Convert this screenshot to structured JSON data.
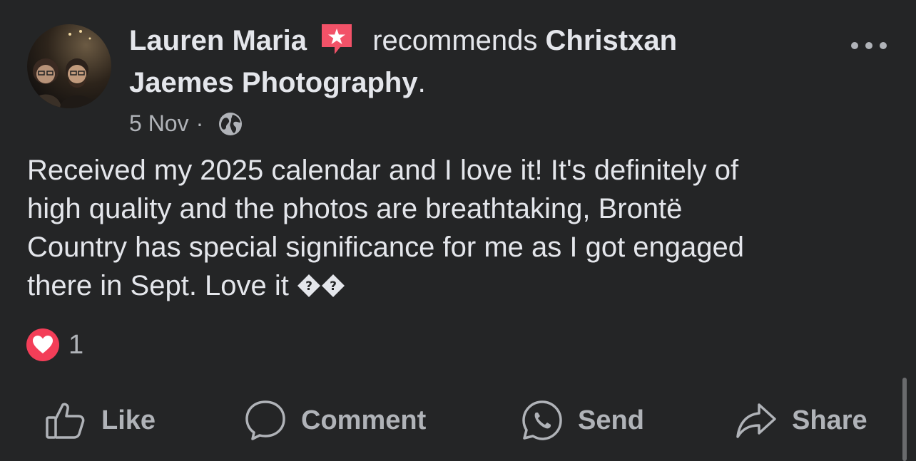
{
  "post": {
    "author": "Lauren Maria",
    "badge_icon": "recommendation-star-badge-icon",
    "verb": "recommends",
    "page_name_line1": "Christxan",
    "page_name_line2": "Jaemes Photography",
    "period": ".",
    "date": "5 Nov",
    "separator": "·",
    "audience_icon": "globe-icon",
    "text_line1": "Received my 2025 calendar and I love it! It's definitely of",
    "text_line2": "high quality and the photos are breathtaking, Brontë",
    "text_line3": "Country has special significance for me as I got engaged",
    "text_line4": "there in Sept. Love it",
    "more_icon": "more-options-icon"
  },
  "reactions": {
    "icon": "love-reaction-icon",
    "count": "1"
  },
  "actions": {
    "like": "Like",
    "comment": "Comment",
    "send": "Send",
    "share": "Share"
  },
  "colors": {
    "background": "#242526",
    "primary_text": "#e4e6eb",
    "secondary_text": "#b0b3b8",
    "badge": "#f25268",
    "love": "#f33e58"
  }
}
